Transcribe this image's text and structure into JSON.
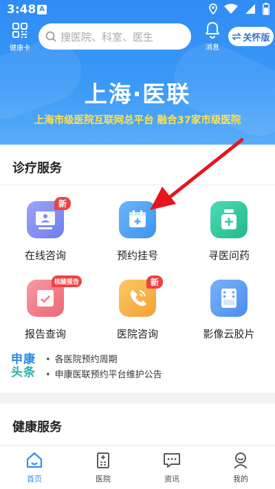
{
  "status_bar": {
    "time": "3:48",
    "notification_badge": "A"
  },
  "header": {
    "card_label": "健康卡",
    "search_placeholder": "搜医院、科室、医生",
    "message_label": "消息",
    "care_mode_label": "关怀版",
    "brand_title": "上海·医联",
    "brand_subtitle": "上海市级医院互联网总平台  融合37家市级医院"
  },
  "services": {
    "title": "诊疗服务",
    "tiles": [
      {
        "label": "在线咨询",
        "badge": "新",
        "icon": "online-consult-icon",
        "color": "#7f8cf3"
      },
      {
        "label": "预约挂号",
        "badge": "",
        "icon": "calendar-plus-icon",
        "color": "#4ea4f6"
      },
      {
        "label": "寻医问药",
        "badge": "",
        "icon": "medicine-bottle-icon",
        "color": "#2fcaa0"
      },
      {
        "label": "报告查询",
        "badge": "核酸报告",
        "icon": "report-check-icon",
        "color": "#f27c86"
      },
      {
        "label": "医院咨询",
        "badge": "新",
        "icon": "phone-icon",
        "color": "#f7b24a"
      },
      {
        "label": "影像云胶片",
        "badge": "",
        "icon": "film-icon",
        "color": "#5b9ef5"
      }
    ]
  },
  "news": {
    "logo_line1": "申康",
    "logo_line2": "头条",
    "items": [
      "各医院预约周期",
      "申康医联预约平台维护公告"
    ]
  },
  "health": {
    "title": "健康服务"
  },
  "tabbar": {
    "active": "home",
    "items": [
      {
        "key": "home",
        "label": "首页",
        "icon": "home-icon"
      },
      {
        "key": "hospital",
        "label": "医院",
        "icon": "hospital-icon"
      },
      {
        "key": "news",
        "label": "资讯",
        "icon": "chat-icon"
      },
      {
        "key": "me",
        "label": "我的",
        "icon": "user-icon"
      }
    ]
  },
  "colors": {
    "primary": "#2f8cf5",
    "accent_yellow": "#ffe14f",
    "badge_red": "#f04141",
    "annotation_arrow": "#e8141e"
  }
}
